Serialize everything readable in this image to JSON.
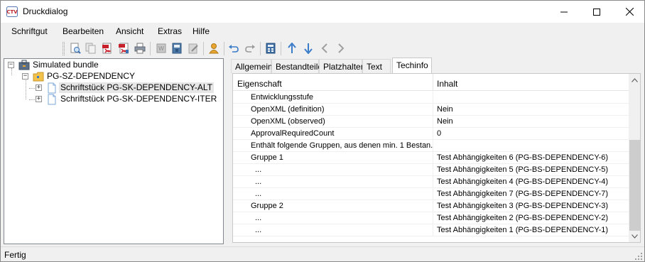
{
  "window": {
    "title": "Druckdialog",
    "app_icon": "ctv-app-icon"
  },
  "menu": {
    "items": [
      {
        "label": "Schriftgut"
      },
      {
        "label": "Bearbeiten"
      },
      {
        "label": "Ansicht"
      },
      {
        "label": "Extras"
      },
      {
        "label": "Hilfe"
      }
    ]
  },
  "toolbar": {
    "buttons": [
      "preview-icon",
      "copy-icon",
      "pdf-icon",
      "pdf-multi-icon",
      "print-icon",
      "word-icon",
      "archive-icon",
      "edit-doc-icon",
      "user-icon",
      "undo-icon",
      "redo-icon",
      "calculator-icon",
      "arrow-up-icon",
      "arrow-down-icon",
      "arrow-left-icon",
      "arrow-right-icon"
    ]
  },
  "tree": {
    "root": {
      "label": "Simulated bundle",
      "expander": "−"
    },
    "group": {
      "label": "PG-SZ-DEPENDENCY",
      "expander": "−"
    },
    "children": [
      {
        "label": "Schriftstück PG-SK-DEPENDENCY-ALT",
        "expander": "+",
        "selected": true
      },
      {
        "label": "Schriftstück PG-SK-DEPENDENCY-ITER",
        "expander": "+",
        "selected": false
      }
    ]
  },
  "tabs": [
    {
      "label": "Allgemein",
      "active": false
    },
    {
      "label": "Bestandteile",
      "active": false
    },
    {
      "label": "Platzhalter",
      "active": false
    },
    {
      "label": "Text",
      "active": false
    },
    {
      "label": "Techinfo",
      "active": true
    }
  ],
  "grid": {
    "columns": [
      "Eigenschaft",
      "Inhalt"
    ],
    "rows": [
      {
        "key": "Entwicklungsstufe",
        "value": ""
      },
      {
        "key": "OpenXML (definition)",
        "value": "Nein"
      },
      {
        "key": "OpenXML (observed)",
        "value": "Nein"
      },
      {
        "key": "ApprovalRequiredCount",
        "value": "0"
      },
      {
        "key": "Enthält folgende Gruppen, aus denen min. 1 Bestan...",
        "value": ""
      },
      {
        "key": "Gruppe 1",
        "value": "Test Abhängigkeiten 6 (PG-BS-DEPENDENCY-6)"
      },
      {
        "key": "...",
        "value": "Test Abhängigkeiten 5 (PG-BS-DEPENDENCY-5)"
      },
      {
        "key": "...",
        "value": "Test Abhängigkeiten 4 (PG-BS-DEPENDENCY-4)"
      },
      {
        "key": "...",
        "value": "Test Abhängigkeiten 7 (PG-BS-DEPENDENCY-7)"
      },
      {
        "key": "Gruppe 2",
        "value": "Test Abhängigkeiten 3 (PG-BS-DEPENDENCY-3)"
      },
      {
        "key": "...",
        "value": "Test Abhängigkeiten 2 (PG-BS-DEPENDENCY-2)"
      },
      {
        "key": "...",
        "value": "Test Abhängigkeiten 1 (PG-BS-DEPENDENCY-1)"
      }
    ]
  },
  "status": {
    "text": "Fertig"
  }
}
